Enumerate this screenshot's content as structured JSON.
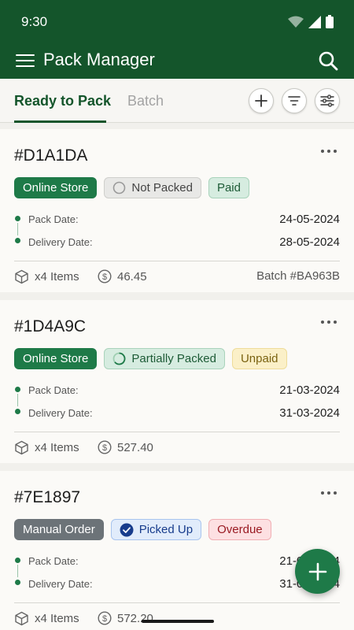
{
  "status_bar": {
    "time": "9:30"
  },
  "app_bar": {
    "title": "Pack Manager"
  },
  "tabs": {
    "active": "Ready to Pack",
    "inactive": "Batch"
  },
  "orders": [
    {
      "id": "#D1A1DA",
      "source": "Online Store",
      "pack_status": "Not Packed",
      "payment": "Paid",
      "pack_date_label": "Pack Date:",
      "pack_date": "24-05-2024",
      "delivery_date_label": "Delivery Date:",
      "delivery_date": "28-05-2024",
      "items": "x4 Items",
      "amount": "46.45",
      "batch": "Batch #BA963B"
    },
    {
      "id": "#1D4A9C",
      "source": "Online Store",
      "pack_status": "Partially Packed",
      "payment": "Unpaid",
      "pack_date_label": "Pack Date:",
      "pack_date": "21-03-2024",
      "delivery_date_label": "Delivery Date:",
      "delivery_date": "31-03-2024",
      "items": "x4 Items",
      "amount": "527.40"
    },
    {
      "id": "#7E1897",
      "source": "Manual Order",
      "pack_status": "Picked Up",
      "payment": "Overdue",
      "pack_date_label": "Pack Date:",
      "pack_date": "21-03-2024",
      "delivery_date_label": "Delivery Date:",
      "delivery_date": "31-03-2024",
      "items": "x4 Items",
      "amount": "572.20"
    }
  ],
  "colors": {
    "brand": "#14552b",
    "accent": "#1e7a48",
    "background": "#f1f0ec"
  }
}
